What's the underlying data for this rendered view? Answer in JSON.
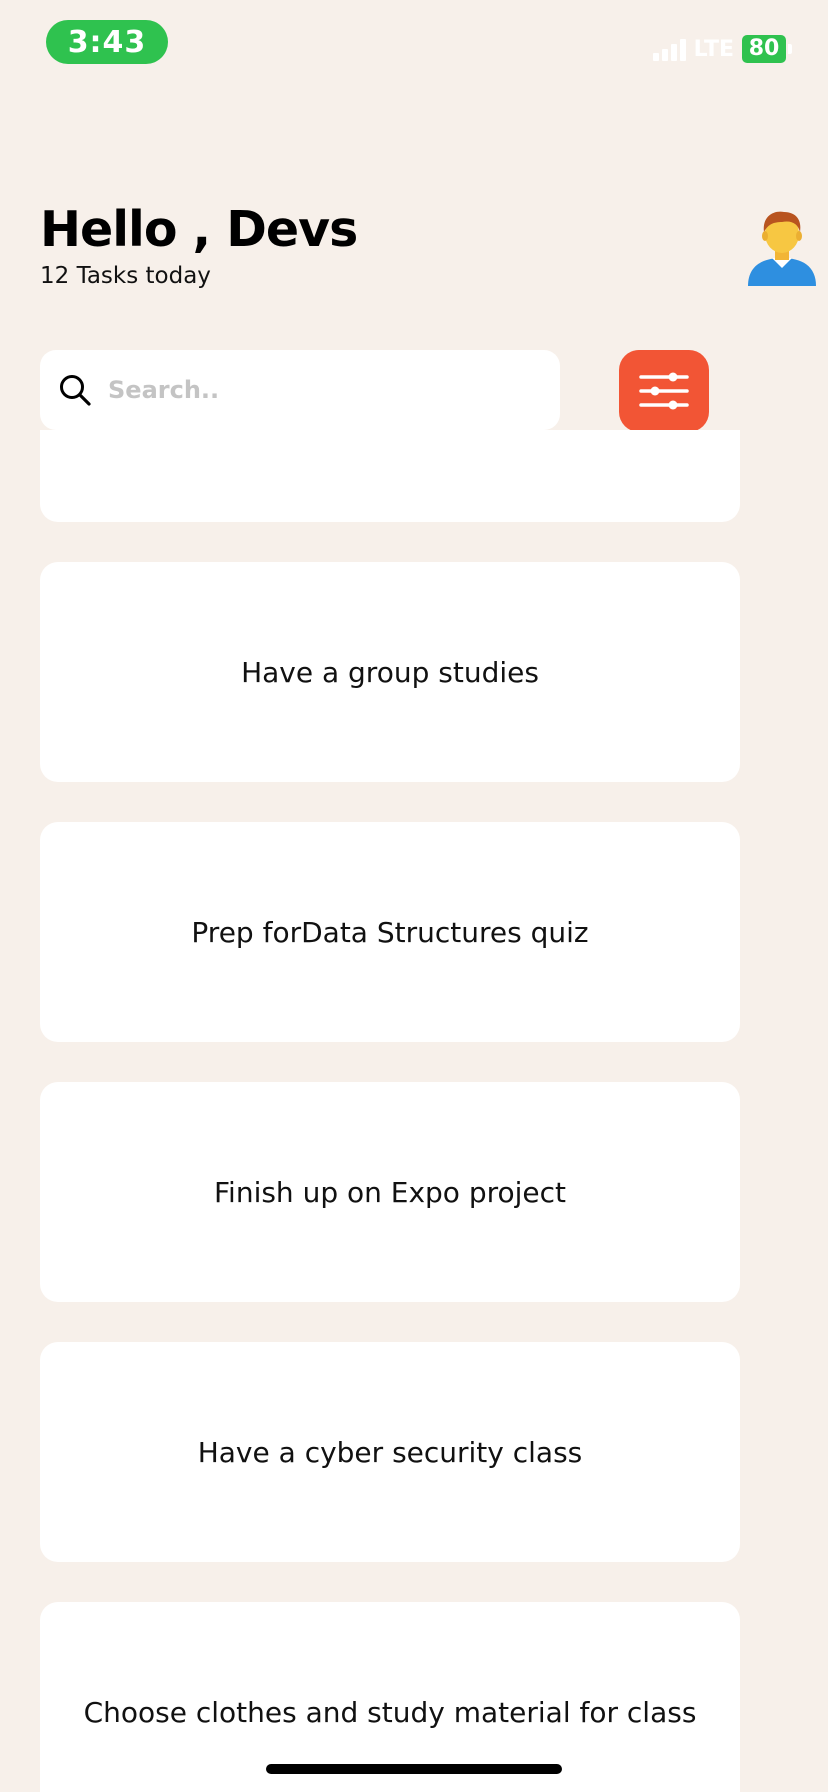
{
  "status_bar": {
    "time": "3:43",
    "network": "LTE",
    "battery": "80",
    "accent_color": "#2FC24F"
  },
  "header": {
    "greeting": "Hello , Devs",
    "subtitle": "12 Tasks today",
    "avatar_icon": "person-emoji-icon"
  },
  "search": {
    "placeholder": "Search..",
    "value": "",
    "icon": "search-icon"
  },
  "filter_button": {
    "icon": "sliders-icon",
    "color": "#F25535"
  },
  "tasks": [
    {
      "label": ""
    },
    {
      "label": "Have a group studies"
    },
    {
      "label": "Prep forData Structures quiz"
    },
    {
      "label": "Finish up on Expo project"
    },
    {
      "label": "Have a cyber security class"
    },
    {
      "label": "Choose clothes and study material for class"
    }
  ],
  "colors": {
    "background": "#F7F0EA",
    "card": "#FFFFFF"
  }
}
